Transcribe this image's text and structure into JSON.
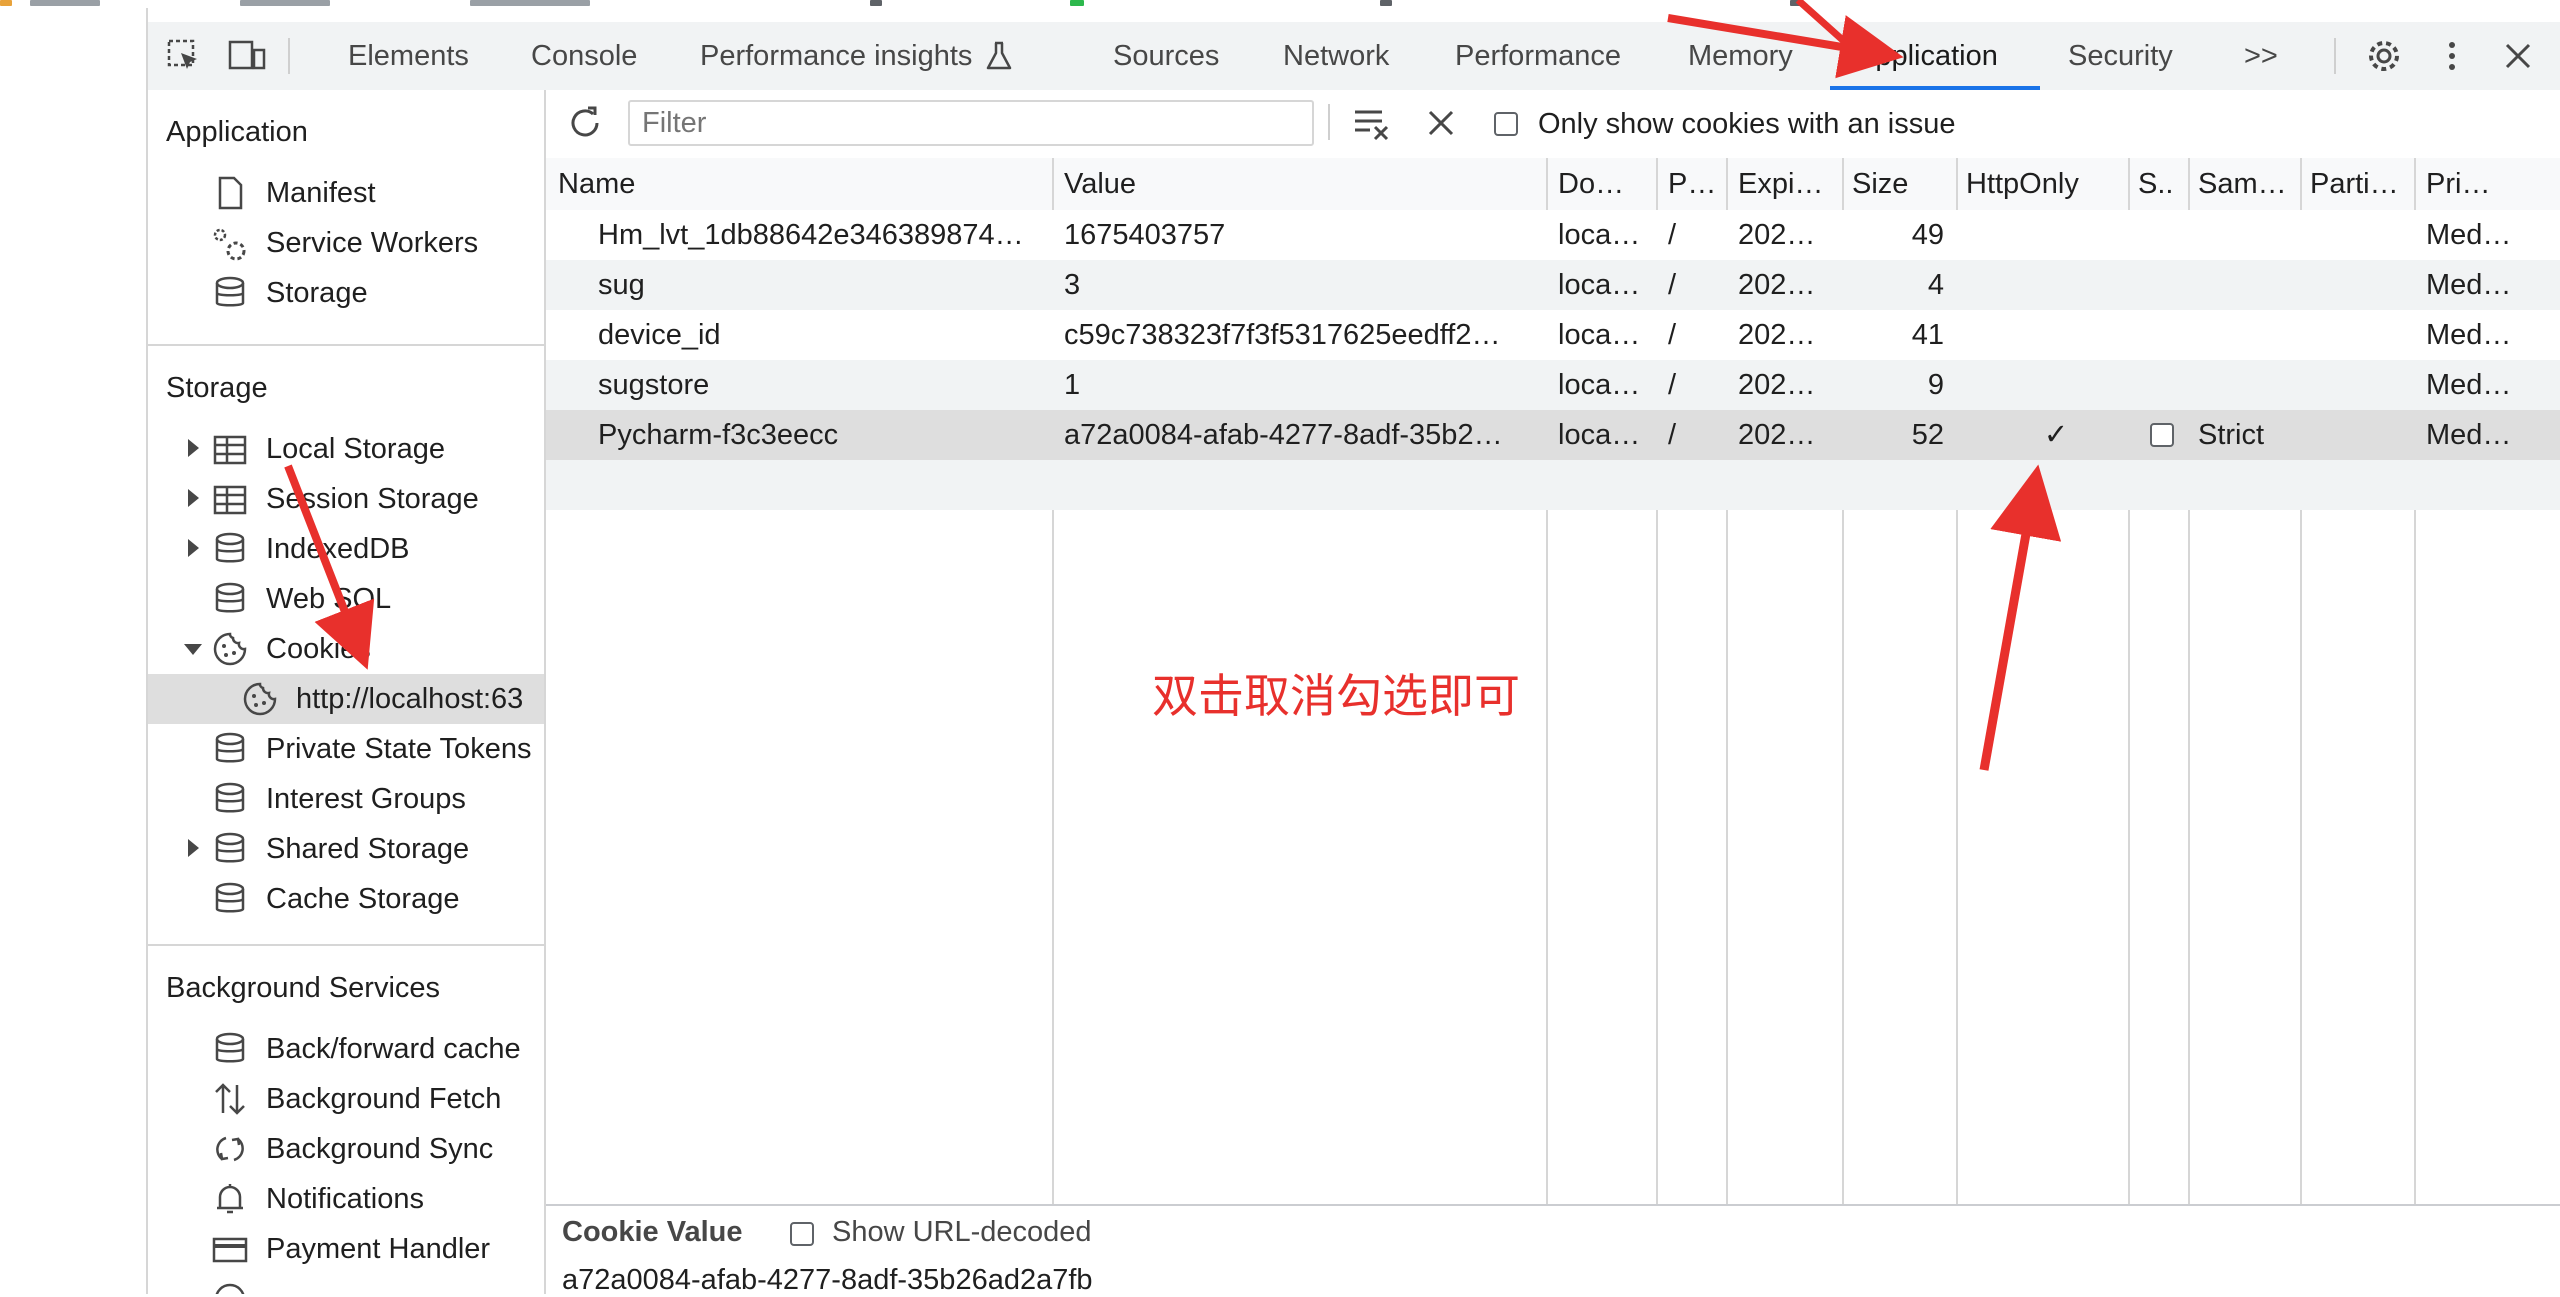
{
  "toolbar": {
    "tabs": [
      {
        "label": "Elements"
      },
      {
        "label": "Console"
      },
      {
        "label": "Performance insights"
      },
      {
        "label": "Sources"
      },
      {
        "label": "Network"
      },
      {
        "label": "Performance"
      },
      {
        "label": "Memory"
      },
      {
        "label": "Application"
      },
      {
        "label": "Security"
      },
      {
        "label": ">>"
      }
    ],
    "active_tab": "Application",
    "accent_color": "#1a73e8"
  },
  "sidebar": {
    "application_heading": "Application",
    "application_items": [
      {
        "label": "Manifest",
        "icon": "document-icon"
      },
      {
        "label": "Service Workers",
        "icon": "gears-icon"
      },
      {
        "label": "Storage",
        "icon": "database-icon"
      }
    ],
    "storage_heading": "Storage",
    "storage_items": [
      {
        "label": "Local Storage",
        "icon": "table-icon"
      },
      {
        "label": "Session Storage",
        "icon": "table-icon"
      },
      {
        "label": "IndexedDB",
        "icon": "database-icon"
      },
      {
        "label": "Web SQL",
        "icon": "database-icon"
      },
      {
        "label": "Cookies",
        "icon": "cookie-icon"
      },
      {
        "label": "http://localhost:63",
        "icon": "cookie-icon"
      },
      {
        "label": "Private State Tokens",
        "icon": "database-icon"
      },
      {
        "label": "Interest Groups",
        "icon": "database-icon"
      },
      {
        "label": "Shared Storage",
        "icon": "database-icon"
      },
      {
        "label": "Cache Storage",
        "icon": "database-icon"
      }
    ],
    "background_heading": "Background Services",
    "background_items": [
      {
        "label": "Back/forward cache",
        "icon": "database-icon"
      },
      {
        "label": "Background Fetch",
        "icon": "up-down-arrows-icon"
      },
      {
        "label": "Background Sync",
        "icon": "sync-icon"
      },
      {
        "label": "Notifications",
        "icon": "bell-icon"
      },
      {
        "label": "Payment Handler",
        "icon": "card-icon"
      }
    ]
  },
  "filterbar": {
    "placeholder": "Filter",
    "only_issues_label": "Only show cookies with an issue"
  },
  "table": {
    "headers": [
      "Name",
      "Value",
      "Do…",
      "P…",
      "Expi…",
      "Size",
      "HttpOnly",
      "S..",
      "Sam…",
      "Parti…",
      "Pri…"
    ],
    "rows": [
      {
        "name": "Hm_lvt_1db88642e346389874…",
        "value": "1675403757",
        "domain": "loca…",
        "path": "/",
        "expires": "202…",
        "size": "49",
        "httponly": "",
        "samesite": "",
        "priority": "Med…"
      },
      {
        "name": "sug",
        "value": "3",
        "domain": "loca…",
        "path": "/",
        "expires": "202…",
        "size": "4",
        "httponly": "",
        "samesite": "",
        "priority": "Med…"
      },
      {
        "name": "device_id",
        "value": "c59c738323f7f3f5317625eedff2…",
        "domain": "loca…",
        "path": "/",
        "expires": "202…",
        "size": "41",
        "httponly": "",
        "samesite": "",
        "priority": "Med…"
      },
      {
        "name": "sugstore",
        "value": "1",
        "domain": "loca…",
        "path": "/",
        "expires": "202…",
        "size": "9",
        "httponly": "",
        "samesite": "",
        "priority": "Med…"
      },
      {
        "name": "Pycharm-f3c3eecc",
        "value": "a72a0084-afab-4277-8adf-35b2…",
        "domain": "loca…",
        "path": "/",
        "expires": "202…",
        "size": "52",
        "httponly": "✓",
        "samesite": "Strict",
        "priority": "Med…"
      }
    ]
  },
  "cookie_panel": {
    "title": "Cookie Value",
    "show_decoded_label": "Show URL-decoded",
    "value": "a72a0084-afab-4277-8adf-35b26ad2a7fb"
  },
  "annotation": {
    "text": "双击取消勾选即可",
    "color": "#e8302c"
  }
}
